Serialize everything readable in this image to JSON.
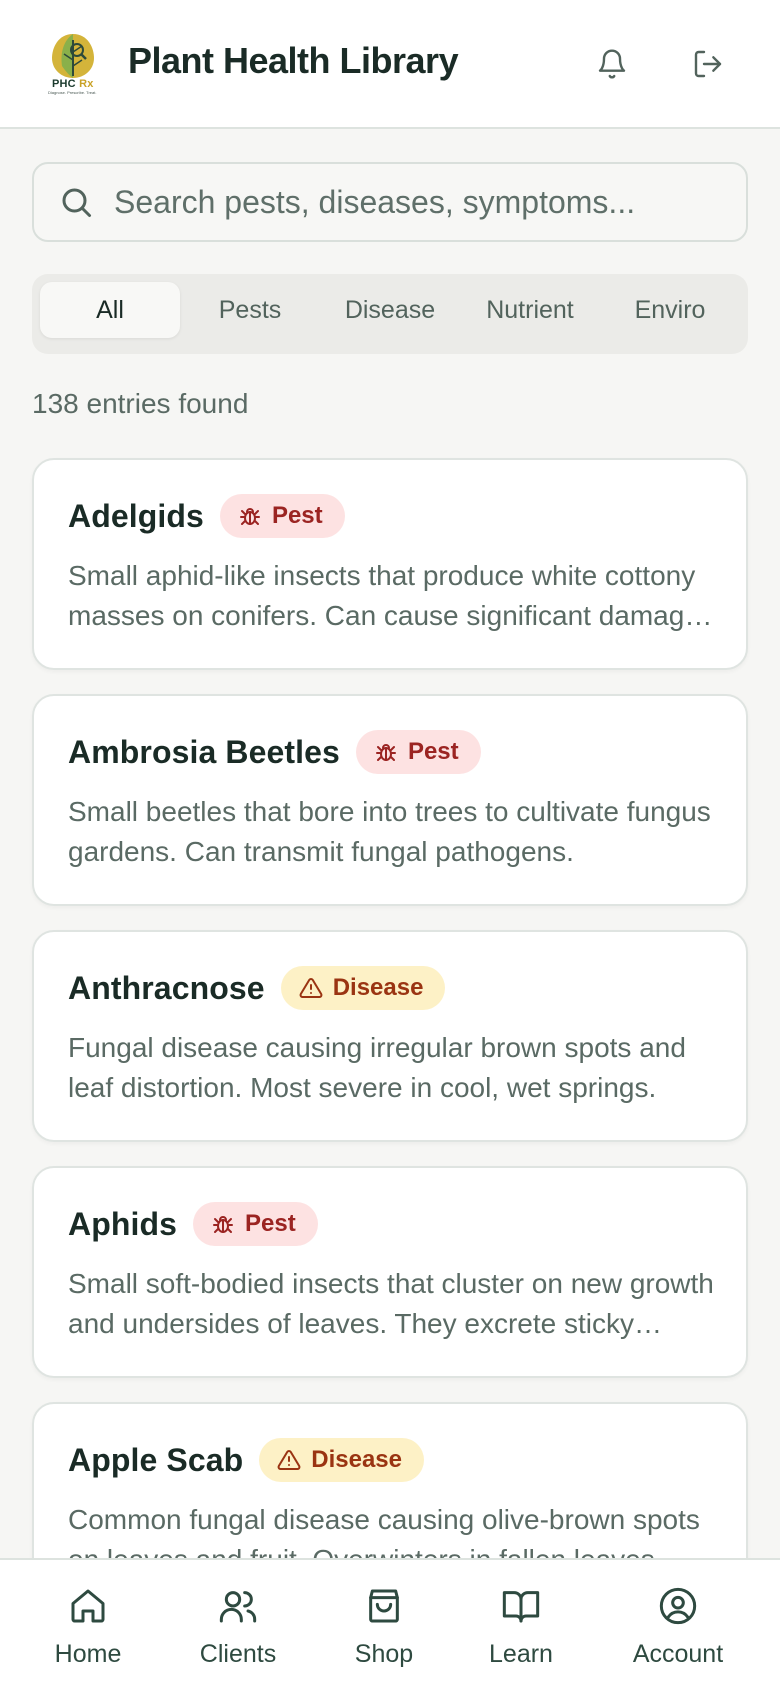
{
  "header": {
    "title": "Plant Health Library",
    "logo_text": "PHC",
    "logo_rx": "Rx",
    "logo_tagline": "Diagnose. Prescribe. Treat.",
    "bell_icon": "bell-icon",
    "logout_icon": "logout-icon"
  },
  "search": {
    "placeholder": "Search pests, diseases, symptoms...",
    "value": ""
  },
  "tabs": [
    {
      "label": "All",
      "active": true
    },
    {
      "label": "Pests",
      "active": false
    },
    {
      "label": "Disease",
      "active": false
    },
    {
      "label": "Nutrient",
      "active": false
    },
    {
      "label": "Enviro",
      "active": false
    }
  ],
  "results": {
    "count_text": "138 entries found"
  },
  "entries": [
    {
      "title": "Adelgids",
      "badge": "Pest",
      "type": "pest",
      "description": "Small aphid-like insects that produce white cottony masses on conifers. Can cause significant damage to hemlocks and firs."
    },
    {
      "title": "Ambrosia Beetles",
      "badge": "Pest",
      "type": "pest",
      "description": "Small beetles that bore into trees to cultivate fungus gardens. Can transmit fungal pathogens."
    },
    {
      "title": "Anthracnose",
      "badge": "Disease",
      "type": "disease",
      "description": "Fungal disease causing irregular brown spots and leaf distortion. Most severe in cool, wet springs."
    },
    {
      "title": "Aphids",
      "badge": "Pest",
      "type": "pest",
      "description": "Small soft-bodied insects that cluster on new growth and undersides of leaves. They excrete sticky honeydew."
    },
    {
      "title": "Apple Scab",
      "badge": "Disease",
      "type": "disease",
      "description": "Common fungal disease causing olive-brown spots on leaves and fruit. Overwinters in fallen leaves."
    }
  ],
  "colors": {
    "pest_badge_bg": "#fde2e2",
    "pest_badge_text": "#9b2422",
    "disease_badge_bg": "#fdf1c6",
    "disease_badge_text": "#9a3412",
    "nav_icon": "#2e4a40"
  },
  "bottom_nav": [
    {
      "label": "Home",
      "icon": "home-icon"
    },
    {
      "label": "Clients",
      "icon": "users-icon"
    },
    {
      "label": "Shop",
      "icon": "shopping-bag-icon"
    },
    {
      "label": "Learn",
      "icon": "book-icon"
    },
    {
      "label": "Account",
      "icon": "user-circle-icon"
    }
  ]
}
